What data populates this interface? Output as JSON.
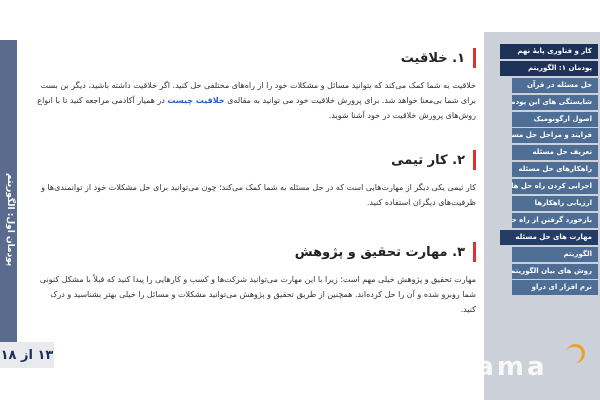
{
  "left_strip": {
    "title": "پودمان اول: الگوریتم"
  },
  "page_counter": "۱۳ از ۱۸",
  "sections": [
    {
      "title": "۱. خلاقیت",
      "body_before_link": "خلاقیت به شما کمک می‌کند که بتوانید مسائل و مشکلات خود را از راه‌های مختلفی حل کنید. اگر خلاقیت داشته باشید، دیگر بن بست برای شما بی‌معنا خواهد شد. برای پرورش خلاقیت خود می توانید به مقاله‌ی ",
      "link": "خلاقیت چیست",
      "body_after_link": " در همیار آکادمی مراجعه کنید تا با انواع روش‌های پرورش خلاقیت در خود آشنا شوید."
    },
    {
      "title": "۲. کار تیمی",
      "body": "کار تیمی یکی دیگر از مهارت‌هایی است که در حل مسئله به شما کمک می‌کند؛ چون می‌توانید برای حل مشکلات خود از توانمندی‌ها و ظرفیت‌های دیگران استفاده کنید."
    },
    {
      "title": "۳. مهارت تحقیق و پژوهش",
      "body": "مهارت تحقیق و پژوهش خیلی مهم است؛ زیرا با این مهارت می‌توانید شرکت‌ها و کسب و کارهایی را پیدا کنید که قبلاً با مشکل کنونی شما روبرو شده و آن را حل کرده‌اند. همچنین از طریق تحقیق و پژوهش می‌توانید مشکلات و مسائل را خیلی بهتر بشناسید و درک کنید."
    }
  ],
  "sidebar": {
    "items": [
      {
        "label": "کار و فناوری پایهٔ نهم",
        "type": "header"
      },
      {
        "label": "پودمان ۱: الگوریتم",
        "type": "header"
      },
      {
        "label": "حل مسئله در قرآن",
        "type": "sub"
      },
      {
        "label": "شایستگی های این پودمان",
        "type": "sub"
      },
      {
        "label": "اصول ارگونومیک",
        "type": "sub"
      },
      {
        "label": "فرایند و مراحل حل مسئله",
        "type": "sub"
      },
      {
        "label": "تعریف حل مسئله",
        "type": "sub"
      },
      {
        "label": "راهکارهای حل مسئله",
        "type": "sub"
      },
      {
        "label": "اجرایی کردن راه حل ها",
        "type": "sub"
      },
      {
        "label": "ارزیابی راهکارها",
        "type": "sub"
      },
      {
        "label": "بازخورد گرفتن از راه حل ها",
        "type": "sub"
      },
      {
        "label": "مهارت های حل مسئله",
        "type": "active"
      },
      {
        "label": "الگوریتم",
        "type": "sub"
      },
      {
        "label": "روش های بیان الگوریتم",
        "type": "sub"
      },
      {
        "label": "نرم افزار ای دراو",
        "type": "sub"
      }
    ]
  },
  "watermark": {
    "text": "Gama"
  },
  "colors": {
    "accent": "#e03030",
    "menu": "#4f6e95",
    "menu_header": "#1e3258",
    "link": "#1f5fbf"
  }
}
